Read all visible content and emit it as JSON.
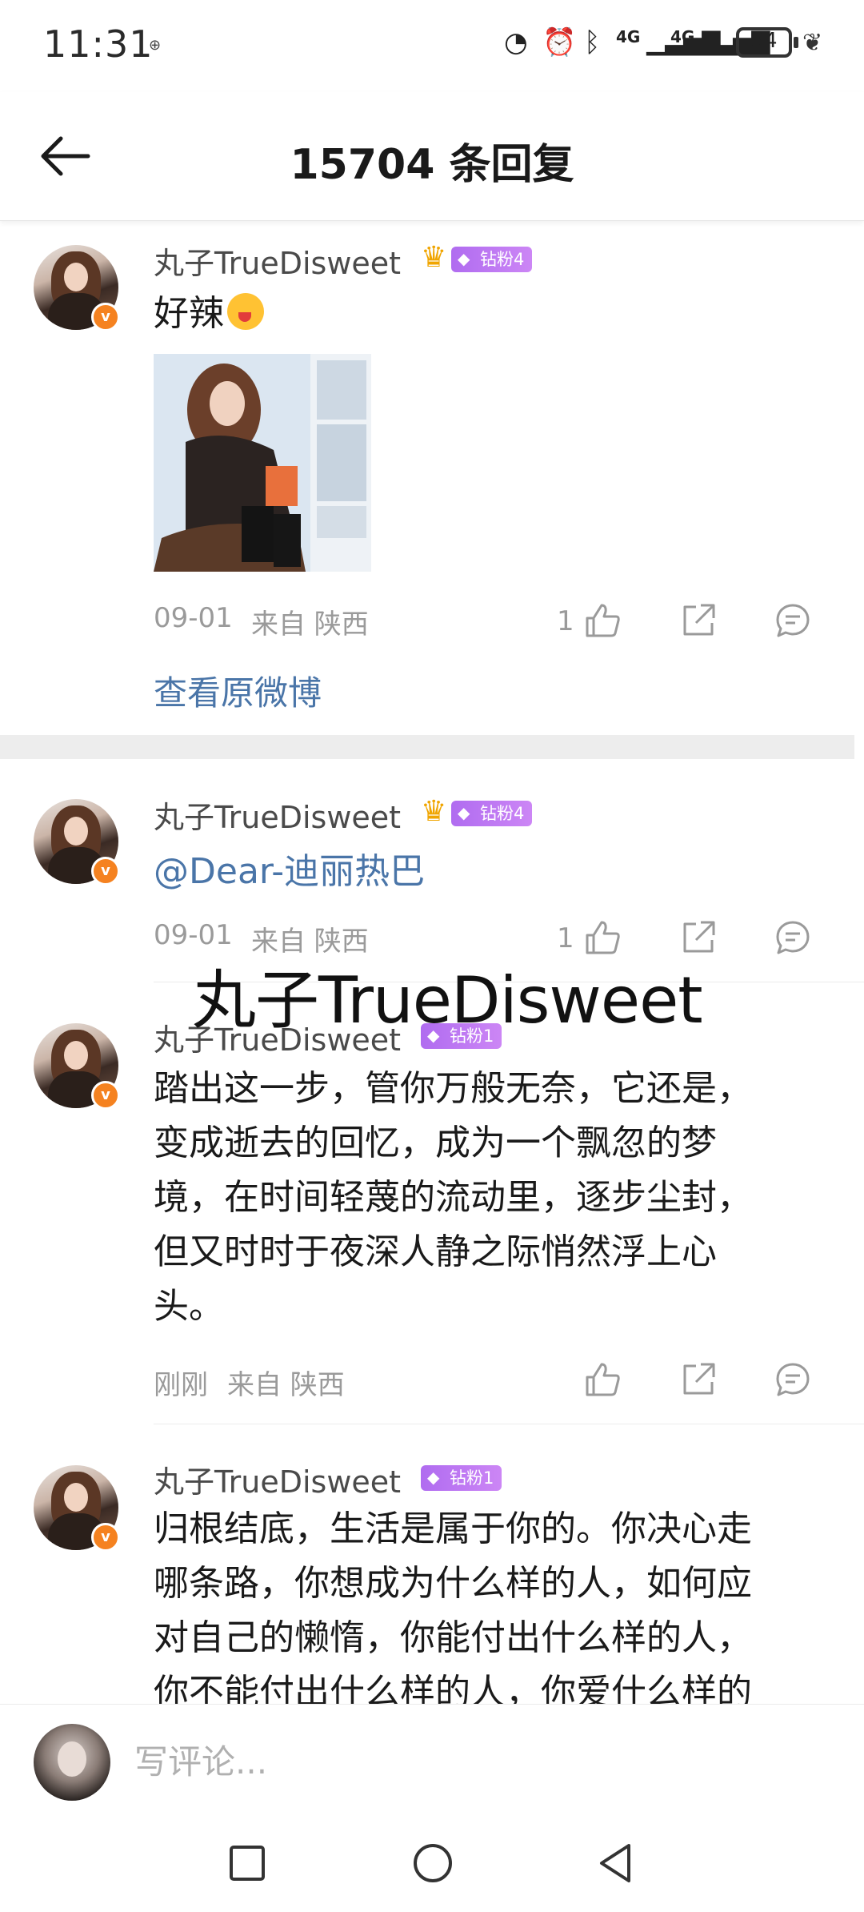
{
  "status_bar": {
    "time": "11:31",
    "network_1": "4G",
    "network_2": "4G",
    "battery": "34"
  },
  "header": {
    "title": "15704 条回复"
  },
  "comments": [
    {
      "username": "丸子TrueDisweet",
      "fan_badge": "钻粉4",
      "text": "好辣",
      "date": "09-01",
      "location": "来自 陕西",
      "likes": "1"
    },
    {
      "username": "丸子TrueDisweet",
      "fan_badge": "钻粉4",
      "mention": "@Dear-迪丽热巴",
      "date": "09-01",
      "location": "来自 陕西",
      "likes": "1"
    },
    {
      "username": "丸子TrueDisweet",
      "fan_badge": "钻粉1",
      "lines": [
        "踏出这一步，管你万般无奈，它还是，",
        "变成逝去的回忆，成为一个飘忽的梦",
        "境，在时间轻蔑的流动里，逐步尘封，",
        "但又时时于夜深人静之际悄然浮上心",
        "头。"
      ],
      "date": "刚刚",
      "location": "来自 陕西"
    },
    {
      "username": "丸子TrueDisweet",
      "fan_badge": "钻粉1",
      "lines": [
        "归根结底，生活是属于你的。你决心走",
        "哪条路，你想成为什么样的人，如何应",
        "对自己的懒惰，你能付出什么样的人，",
        "你不能付出什么样的人，你爱什么样的"
      ]
    }
  ],
  "view_original": "查看原微博",
  "watermark": "丸子TrueDisweet",
  "comment_bar": {
    "placeholder": "写评论..."
  },
  "icons": {
    "back": "back-arrow-icon",
    "like": "thumbs-up-icon",
    "share": "share-icon",
    "reply": "comment-icon",
    "verified": "verified-v-icon"
  },
  "colors": {
    "link": "#4a75a8",
    "verified_badge": "#f58220",
    "fan_badge": "#b06cf0"
  }
}
